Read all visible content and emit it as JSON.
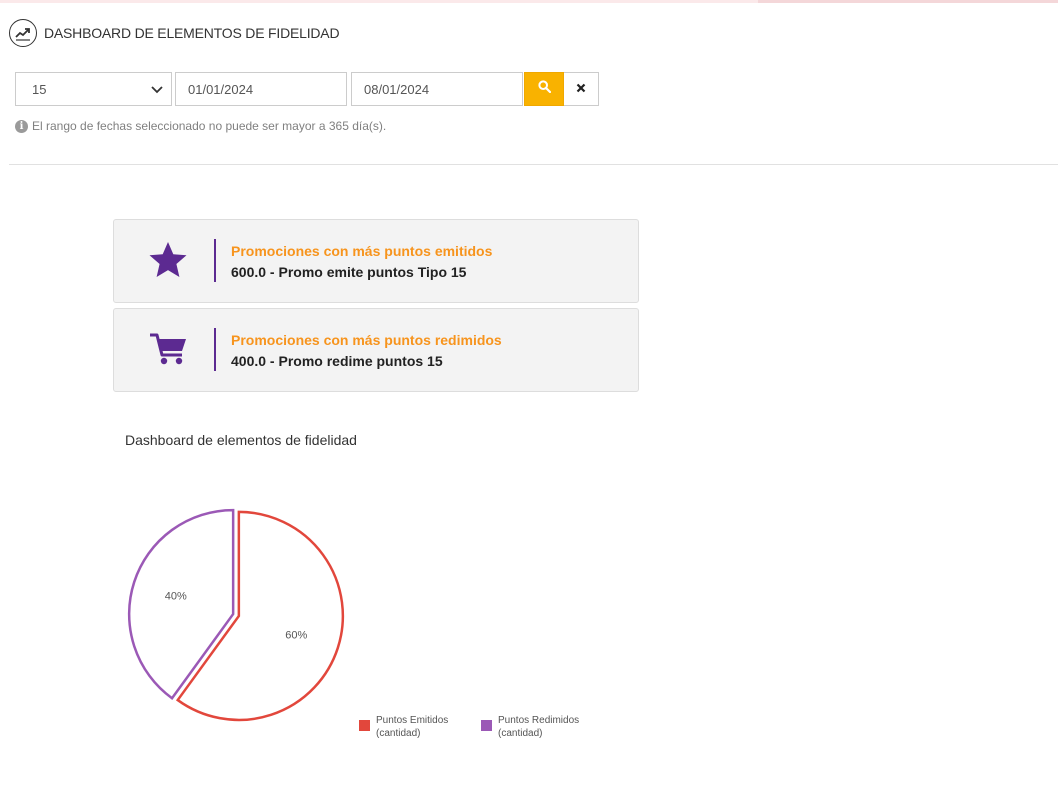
{
  "header": {
    "title": "DASHBOARD DE ELEMENTOS DE FIDELIDAD",
    "icon": "trending-up-icon"
  },
  "filters": {
    "select_value": "15",
    "date_start": "01/01/2024",
    "date_end": "08/01/2024",
    "search_icon": "search-icon",
    "clear_icon": "close-icon",
    "hint": "El rango de fechas seleccionado no puede ser mayor a 365 día(s)."
  },
  "cards": [
    {
      "icon": "star-icon",
      "title": "Promociones con más puntos emitidos",
      "value": "600.0 - Promo emite puntos Tipo 15"
    },
    {
      "icon": "cart-icon",
      "title": "Promociones con más puntos redimidos",
      "value": "400.0 - Promo redime puntos 15"
    }
  ],
  "colors": {
    "accent_orange": "#f7941d",
    "accent_purple": "#5c2a91",
    "search_button": "#f9b200"
  },
  "chart_data": {
    "type": "pie",
    "title": "Dashboard de elementos de fidelidad",
    "series": [
      {
        "name": "Puntos Emitidos (cantidad)",
        "legend_lines": [
          "Puntos Emitidos",
          "(cantidad)"
        ],
        "value": 60,
        "label": "60%",
        "color": "#e2473c"
      },
      {
        "name": "Puntos Redimidos (cantidad)",
        "legend_lines": [
          "Puntos Redimidos",
          "(cantidad)"
        ],
        "value": 40,
        "label": "40%",
        "color": "#9b59b6"
      }
    ],
    "legend_placement": "bottom-right"
  }
}
